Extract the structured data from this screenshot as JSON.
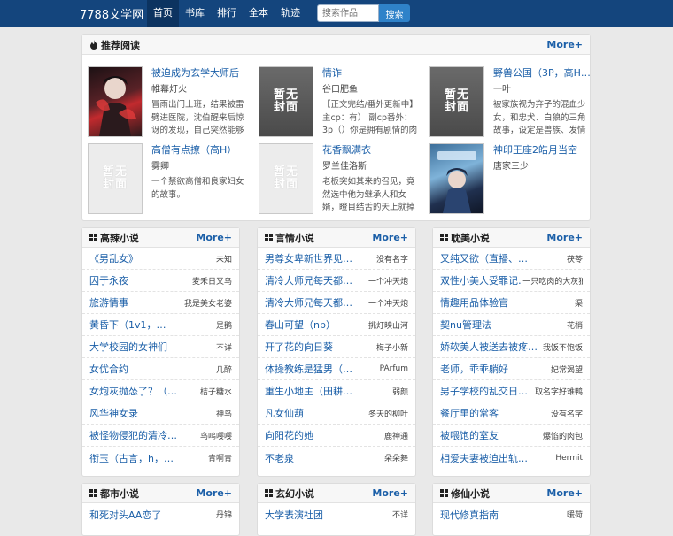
{
  "header": {
    "logo": "7788文学网",
    "nav": [
      "首页",
      "书库",
      "排行",
      "全本",
      "轨迹"
    ],
    "search_placeholder": "搜索作品",
    "search_button": "搜索"
  },
  "recommend": {
    "title": "推荐阅读",
    "more": "More+",
    "items": [
      {
        "title": "被迫成为玄学大师后",
        "author": "帷幕灯火",
        "desc": "冒雨出门上班，结果被雷劈进医院，沈伯醒来后惊讶的发现，自己突然能够看到他人的",
        "cover": "art"
      },
      {
        "title": "情诈",
        "author": "谷口肥鱼",
        "desc": "【正文完结/番外更新中】主cp：有） 副cp番外：3p（）你是拥有剧情的肉更新到正比",
        "cover": "placeholder-dark"
      },
      {
        "title": "野兽公国（3P，高H，…",
        "author": "一叶",
        "desc": "被家族视为弃子的混血少女，和忠犬、白狼的三角故事，设定是兽族、发情期之类的，",
        "cover": "placeholder-dark"
      },
      {
        "title": "高僧有点撩（高H）",
        "author": "雾卿",
        "desc": "一个禁欲高僧和良家妇女的故事。",
        "cover": "placeholder"
      },
      {
        "title": "花香飘满衣",
        "author": "罗兰佳洛斯",
        "desc": "老板突如其来的召见，竟然选中他为继承人和女婿，瞪目结舌的天上就掉下了个艳福的'岳",
        "cover": "placeholder"
      },
      {
        "title": "神印王座2皓月当空",
        "author": "唐家三少",
        "desc": "",
        "cover": "art2"
      }
    ],
    "cover_placeholder_text": "暂无封面"
  },
  "sections": [
    {
      "title": "高辣小说",
      "more": "More+",
      "items": [
        {
          "title": "《男乱女》",
          "author": "未知"
        },
        {
          "title": "囚于永夜",
          "author": "麦禾日又鸟"
        },
        {
          "title": "旅游情事",
          "author": "我是美女老婆"
        },
        {
          "title": "黄昏下（1v1，…",
          "author": "是鹅"
        },
        {
          "title": "大学校园的女神们",
          "author": "不详"
        },
        {
          "title": "女优合约",
          "author": "几醉"
        },
        {
          "title": "女炮灰抛怂了？（…",
          "author": "桔子糖水"
        },
        {
          "title": "风华神女录",
          "author": "神鸟"
        },
        {
          "title": "被怪物侵犯的清冷…",
          "author": "鸟鸣嘤嘤"
        },
        {
          "title": "衔玉（古言，h，…",
          "author": "青啊青"
        }
      ]
    },
    {
      "title": "言情小说",
      "more": "More+",
      "items": [
        {
          "title": "男尊女卑新世界见…",
          "author": "没有名字"
        },
        {
          "title": "清冷大师兄每天都…",
          "author": "一个冲天炮"
        },
        {
          "title": "清冷大师兄每天都…",
          "author": "一个冲天炮"
        },
        {
          "title": "春山可望（np）",
          "author": "挑灯映山河"
        },
        {
          "title": "开了花的向日葵",
          "author": "梅子小新"
        },
        {
          "title": "体操教练是猛男（…",
          "author": "PArfum"
        },
        {
          "title": "重生小地主（田耕…",
          "author": "弱颜"
        },
        {
          "title": "凡女仙葫",
          "author": "冬天的柳叶"
        },
        {
          "title": "向阳花的她",
          "author": "鹿神通"
        },
        {
          "title": "不老泉",
          "author": "朵朵舞"
        }
      ]
    },
    {
      "title": "耽美小说",
      "more": "More+",
      "items": [
        {
          "title": "又纯又欲（直播、…",
          "author": "茯苓"
        },
        {
          "title": "双性小美人受罪记…",
          "author": "一只吃肉的大灰狼"
        },
        {
          "title": "情趣用品体验官",
          "author": "渠"
        },
        {
          "title": "契nu管理法",
          "author": "花梢"
        },
        {
          "title": "娇软美人被送去被疼…",
          "author": "我饭不饱饭"
        },
        {
          "title": "老师，乖乖躺好",
          "author": "妃常渴望"
        },
        {
          "title": "男子学校的乱交日…",
          "author": "取名字好难鸭"
        },
        {
          "title": "餐厅里的常客",
          "author": "没有名字"
        },
        {
          "title": "被喂饱的室友",
          "author": "爆馅的肉包"
        },
        {
          "title": "相爱夫妻被迫出轨…",
          "author": "Hermit"
        }
      ]
    },
    {
      "title": "都市小说",
      "more": "More+",
      "items": [
        {
          "title": "和死对头AA恋了",
          "author": "丹锦"
        }
      ]
    },
    {
      "title": "玄幻小说",
      "more": "More+",
      "items": [
        {
          "title": "大学表演社团",
          "author": "不详"
        }
      ]
    },
    {
      "title": "修仙小说",
      "more": "More+",
      "items": [
        {
          "title": "现代修真指南",
          "author": "暖荷"
        }
      ]
    }
  ]
}
